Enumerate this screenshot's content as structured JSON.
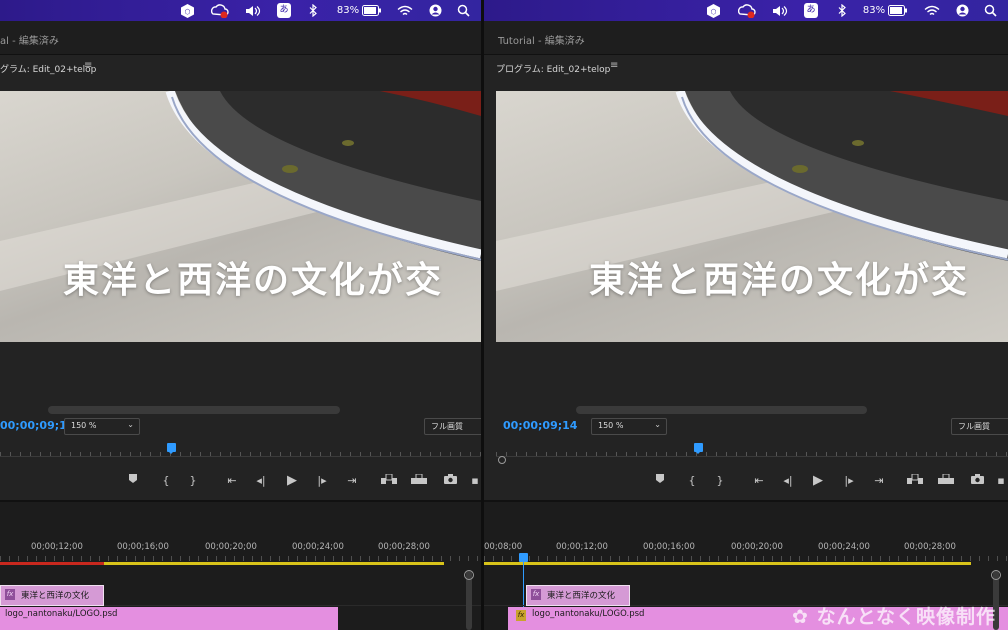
{
  "menubar": {
    "battery": "83%",
    "input_method": "あ",
    "icons": [
      "app-shield-icon",
      "creative-cloud-icon",
      "volume-icon",
      "input-method-icon",
      "bluetooth-icon",
      "battery-icon",
      "wifi-icon",
      "user-icon",
      "search-icon"
    ]
  },
  "left": {
    "title": "al - 編集済み",
    "panel_title": "グラム: Edit_02+telop",
    "caption": "東洋と西洋の文化が交",
    "timecode": "00;00;09;14",
    "zoom": "150 %",
    "quality": "フル画質",
    "ruler": [
      "00;00;12;00",
      "00;00;16;00",
      "00;00;20;00",
      "00;00;24;00",
      "00;00;28;00"
    ],
    "clips": {
      "title_clip": "東洋と西洋の文化",
      "logo_clip": "logo_nantonaku/LOGO.psd"
    }
  },
  "right": {
    "title": "Tutorial - 編集済み",
    "panel_title": "プログラム: Edit_02+telop",
    "caption": "東洋と西洋の文化が交",
    "timecode": "00;00;09;14",
    "zoom": "150 %",
    "quality": "フル画質",
    "ruler": [
      "00;08;00",
      "00;00;12;00",
      "00;00;16;00",
      "00;00;20;00",
      "00;00;24;00",
      "00;00;28;00"
    ],
    "clips": {
      "title_clip": "東洋と西洋の文化",
      "logo_clip": "logo_nantonaku/LOGO.psd"
    }
  },
  "fx_label": "fx",
  "menu_glyph": "≡",
  "dropdown_glyph": "⌄",
  "watermark": "なんとなく映像制作",
  "colors": {
    "menubar": "#3a22a8",
    "timecode": "#2f9bff",
    "clip_pink": "#e48fe0",
    "title_clip": "#d59ad5",
    "workarea_yellow": "#d8c31a",
    "render_red": "#c8281e"
  }
}
